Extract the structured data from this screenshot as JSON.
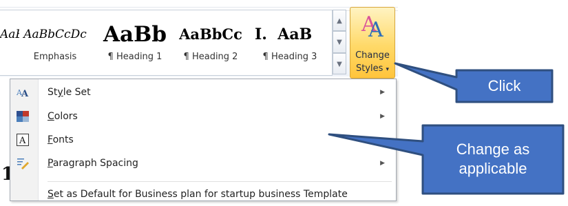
{
  "styles_gallery": {
    "items": [
      {
        "sample": "AaBbCcDc",
        "label": "",
        "style": "partial"
      },
      {
        "sample": "AaBbCcDc",
        "label": "Emphasis",
        "style": "italic"
      },
      {
        "sample": "AaBb",
        "label": "¶ Heading 1",
        "style": "h1"
      },
      {
        "sample": "AaBbCc",
        "label": "¶ Heading 2",
        "style": "h2"
      },
      {
        "sample": "I.",
        "label": "",
        "style": "h3a"
      },
      {
        "sample": "AaB",
        "label": "¶ Heading 3",
        "style": "h3b"
      }
    ]
  },
  "change_styles": {
    "label_line1": "Change",
    "label_line2": "Styles",
    "caret": "▾",
    "icon": "change-styles-icon"
  },
  "menu": {
    "items": [
      {
        "pre": "St",
        "u": "y",
        "post": "le Set",
        "icon": "style-set-icon",
        "submenu": true
      },
      {
        "pre": "",
        "u": "C",
        "post": "olors",
        "icon": "colors-icon",
        "submenu": true
      },
      {
        "pre": "",
        "u": "F",
        "post": "onts",
        "icon": "fonts-icon",
        "submenu": false
      },
      {
        "pre": "",
        "u": "P",
        "post": "aragraph Spacing",
        "icon": "paragraph-spacing-icon",
        "submenu": true
      },
      {
        "pre": "",
        "u": "S",
        "post": "et as Default for Business plan for startup business Template",
        "icon": "",
        "submenu": false
      }
    ],
    "arrow": "▶"
  },
  "callouts": {
    "click": "Click",
    "change_line1": "Change as",
    "change_line2": "applicable"
  },
  "colors": {
    "callout_fill": "#4472c4",
    "callout_stroke": "#2f4f7f",
    "change_styles_bg": "#ffd968"
  }
}
